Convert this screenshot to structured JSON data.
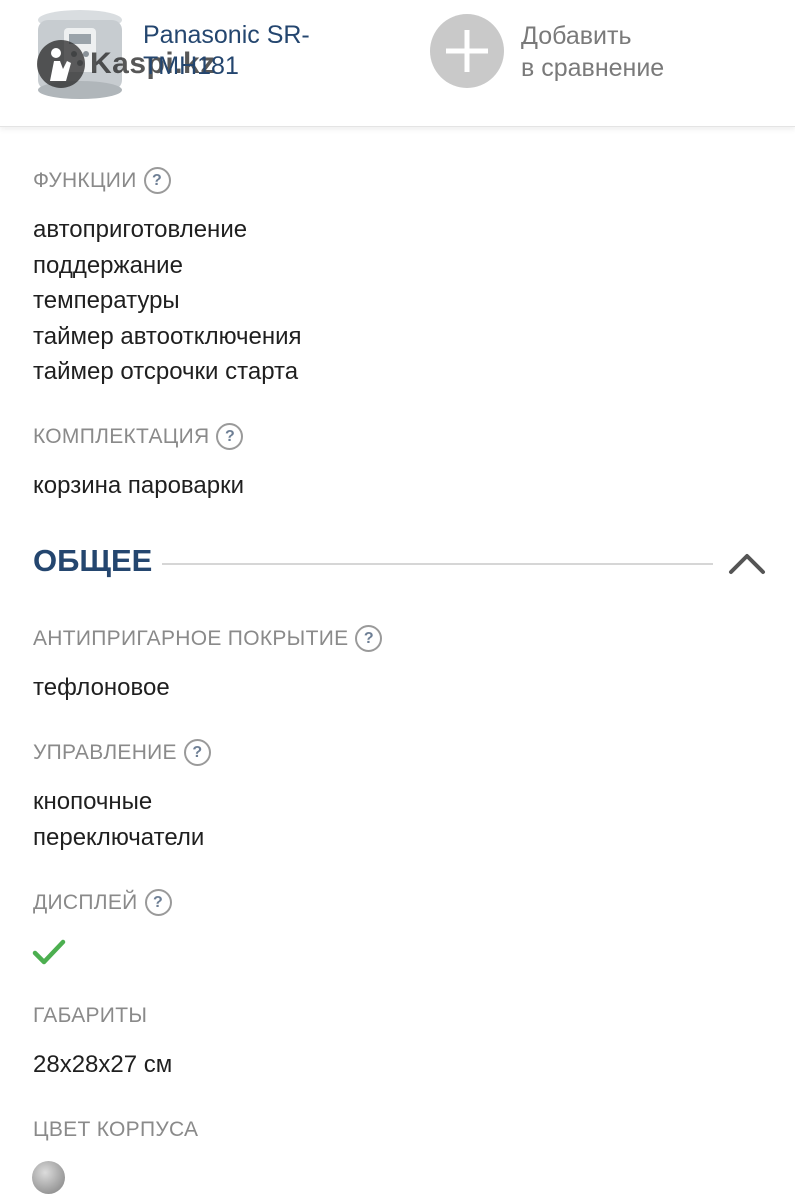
{
  "header": {
    "product_name": "Panasonic SR-TMH181",
    "watermark": "Kaspi.kz",
    "compare_label_line1": "Добавить",
    "compare_label_line2": "в сравнение"
  },
  "specs_top": [
    {
      "label": "ФУНКЦИИ",
      "help": "?",
      "values": [
        "автоприготовление",
        "поддержание",
        "температуры",
        "таймер автоотключения",
        "таймер отсрочки старта"
      ]
    },
    {
      "label": "КОМПЛЕКТАЦИЯ",
      "help": "?",
      "values": [
        "корзина пароварки"
      ]
    }
  ],
  "section": {
    "title": "ОБЩЕЕ",
    "collapse_icon": "chevron-up-icon"
  },
  "specs_general": [
    {
      "label": "АНТИПРИГАРНОЕ ПОКРЫТИЕ",
      "help": "?",
      "values": [
        "тефлоновое"
      ]
    },
    {
      "label": "УПРАВЛЕНИЕ",
      "help": "?",
      "values": [
        "кнопочные",
        "переключатели"
      ]
    },
    {
      "label": "ДИСПЛЕЙ",
      "help": "?",
      "value_icon": "checkmark-icon",
      "check_color": "#4caf50"
    },
    {
      "label": "ГАБАРИТЫ",
      "values": [
        "28x28x27 см"
      ]
    },
    {
      "label": "ЦВЕТ КОРПУСА",
      "value_icon": "color-swatch-silver"
    }
  ],
  "colors": {
    "accent": "#24466f",
    "label_gray": "#8a8a8a",
    "check_green": "#4caf50"
  }
}
